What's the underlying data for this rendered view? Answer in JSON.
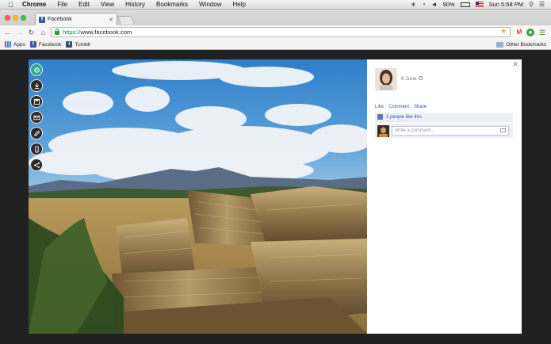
{
  "menubar": {
    "app_name": "Chrome",
    "menus": [
      "File",
      "Edit",
      "View",
      "History",
      "Bookmarks",
      "Window",
      "Help"
    ],
    "battery": "90%",
    "clock": "Sun 5:58 PM"
  },
  "tab": {
    "title": "Facebook",
    "favicon": "f"
  },
  "address": {
    "scheme": "https://",
    "host": "www.facebook.com"
  },
  "bookmarks": {
    "items": [
      {
        "label": "Apps",
        "icon": "apps-icon"
      },
      {
        "label": "Facebook",
        "icon": "facebook-icon"
      },
      {
        "label": "Tumblr",
        "icon": "tumblr-icon"
      }
    ],
    "other": "Other Bookmarks"
  },
  "panel": {
    "date": "6 June",
    "actions": {
      "like": "Like",
      "comment": "Comment",
      "share": "Share",
      "separator": "·"
    },
    "likes_text": "3 people like this.",
    "comment_placeholder": "Write a comment..."
  },
  "colors": {
    "facebook_blue": "#3b5998",
    "viewer_bg": "#202020",
    "tool_logo": "#2fa98c"
  },
  "tools": [
    "logo-icon",
    "download-icon",
    "save-icon",
    "email-icon",
    "edit-icon",
    "mobile-icon",
    "share-icon"
  ]
}
